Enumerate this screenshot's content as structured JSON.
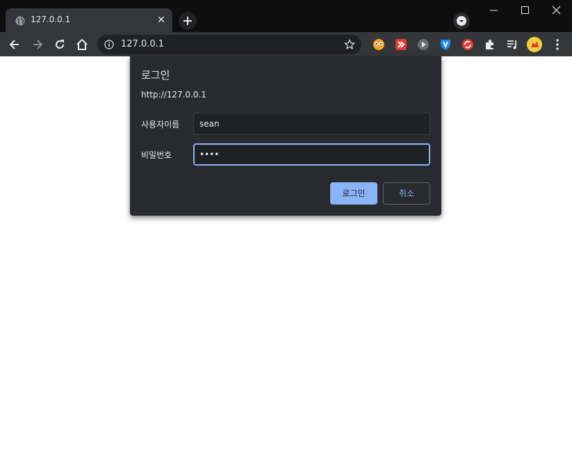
{
  "browser": {
    "tab": {
      "title": "127.0.0.1",
      "close_glyph": "✕"
    },
    "new_tab_glyph": "+",
    "address_bar": {
      "url": "127.0.0.1"
    },
    "extensions": [
      {
        "name": "owl-extension-icon",
        "color": "#f5a623"
      },
      {
        "name": "red-forward-extension-icon",
        "color": "#e53935"
      },
      {
        "name": "play-extension-icon",
        "color": "#9aa0a6"
      },
      {
        "name": "shield-extension-icon",
        "color": "#1e88e5"
      },
      {
        "name": "sync-extension-icon",
        "color": "#e53935"
      }
    ],
    "accent_color": "#8ab4f8"
  },
  "dialog": {
    "title": "로그인",
    "origin": "http://127.0.0.1",
    "username": {
      "label": "사용자이름",
      "value": "sean"
    },
    "password": {
      "label": "비밀번호",
      "value": "••••"
    },
    "login_button": "로그인",
    "cancel_button": "취소"
  }
}
